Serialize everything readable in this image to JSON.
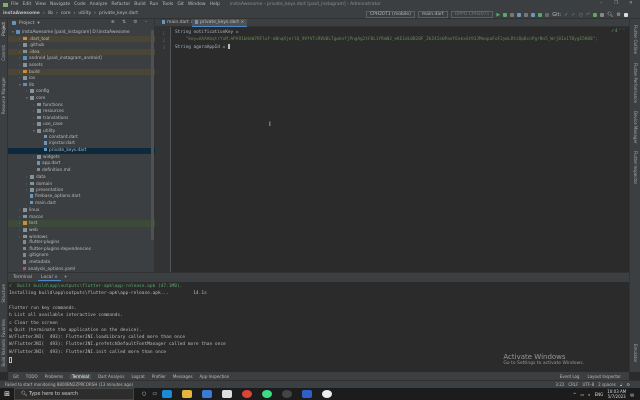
{
  "menubar": {
    "items": [
      "File",
      "Edit",
      "View",
      "Navigate",
      "Code",
      "Analyze",
      "Refactor",
      "Build",
      "Run",
      "Tools",
      "Git",
      "Window",
      "Help"
    ],
    "title": "instaAwesome - private_keys.dart [paid_instagram] - Administrator"
  },
  "breadcrumb": [
    "instaAwesome",
    "lib",
    "core",
    "utility",
    "private_keys.dart"
  ],
  "runbar": {
    "device": "CPH2071 (mobile)",
    "config": "main.dart",
    "target": "OPPO CPH2071",
    "git_label": "Git:"
  },
  "project": {
    "label": "Project",
    "rows": [
      {
        "d": 0,
        "t": "instaAwesome [paid_instagram] D:\\instaAwesome",
        "k": "folder blue",
        "e": "v"
      },
      {
        "d": 1,
        "t": ".dart_tool",
        "k": "folder orange",
        "e": ">",
        "c": "hl"
      },
      {
        "d": 1,
        "t": ".github",
        "k": "folder",
        "e": ">"
      },
      {
        "d": 1,
        "t": ".idea",
        "k": "folder",
        "e": ">",
        "c": "hl"
      },
      {
        "d": 1,
        "t": "android [paid_instagram_android]",
        "k": "folder blue",
        "e": ">"
      },
      {
        "d": 1,
        "t": "assets",
        "k": "folder",
        "e": ">"
      },
      {
        "d": 1,
        "t": "build",
        "k": "folder orange",
        "e": ">",
        "c": "hl"
      },
      {
        "d": 1,
        "t": "ios",
        "k": "folder",
        "e": ">"
      },
      {
        "d": 1,
        "t": "lib",
        "k": "folder blue",
        "e": "v"
      },
      {
        "d": 2,
        "t": "config",
        "k": "folder",
        "e": ">"
      },
      {
        "d": 2,
        "t": "core",
        "k": "folder",
        "e": "v"
      },
      {
        "d": 3,
        "t": "functions",
        "k": "folder",
        "e": ">"
      },
      {
        "d": 3,
        "t": "resources",
        "k": "folder",
        "e": ">"
      },
      {
        "d": 3,
        "t": "translations",
        "k": "folder",
        "e": ">"
      },
      {
        "d": 3,
        "t": "use_case",
        "k": "folder",
        "e": ">"
      },
      {
        "d": 3,
        "t": "utility",
        "k": "folder",
        "e": "v"
      },
      {
        "d": 4,
        "t": "constant.dart",
        "k": "file",
        "e": ""
      },
      {
        "d": 4,
        "t": "injector.dart",
        "k": "file",
        "e": ""
      },
      {
        "d": 4,
        "t": "private_keys.dart",
        "k": "file",
        "e": "",
        "c": "sel"
      },
      {
        "d": 3,
        "t": "widgets",
        "k": "folder",
        "e": ">"
      },
      {
        "d": 3,
        "t": "app.dart",
        "k": "file",
        "e": ""
      },
      {
        "d": 3,
        "t": "definition.md",
        "k": "fileg",
        "e": ""
      },
      {
        "d": 2,
        "t": "data",
        "k": "folder",
        "e": ">"
      },
      {
        "d": 2,
        "t": "domain",
        "k": "folder",
        "e": ">"
      },
      {
        "d": 2,
        "t": "presentation",
        "k": "folder",
        "e": ">"
      },
      {
        "d": 2,
        "t": "firebase_options.dart",
        "k": "file",
        "e": ""
      },
      {
        "d": 2,
        "t": "main.dart",
        "k": "file",
        "e": ""
      },
      {
        "d": 1,
        "t": "linux",
        "k": "folder",
        "e": ">"
      },
      {
        "d": 1,
        "t": "macos",
        "k": "folder",
        "e": ">"
      },
      {
        "d": 1,
        "t": "test",
        "k": "folder orange",
        "e": ">",
        "c": "green"
      },
      {
        "d": 1,
        "t": "web",
        "k": "folder",
        "e": ">"
      },
      {
        "d": 1,
        "t": "windows",
        "k": "folder",
        "e": ">"
      },
      {
        "d": 1,
        "t": ".flutter-plugins",
        "k": "fileg",
        "e": ""
      },
      {
        "d": 1,
        "t": ".flutter-plugins-dependencies",
        "k": "fileg",
        "e": ""
      },
      {
        "d": 1,
        "t": ".gitignore",
        "k": "fileg",
        "e": ""
      },
      {
        "d": 1,
        "t": ".metadata",
        "k": "fileg",
        "e": ""
      },
      {
        "d": 1,
        "t": "analysis_options.yaml",
        "k": "filer",
        "e": ""
      }
    ]
  },
  "editor": {
    "tabs": [
      "main.dart",
      "private_keys.dart"
    ],
    "active_tab": 1,
    "lines": [
      {
        "n": "1",
        "code": "String notificationKey ="
      },
      {
        "n": "2",
        "str": "    \"key=AAAAbqtrYuM:APA91bHoW7RFlof-mBnqXjerlO_9VfVTsRVU0LTgwknfjPngAg2tF0L1fRmN3_eKE1dL0B20F_ZkZ4Ie0PaeYEekxGt93JMeopaFoF2ymLRtzDpBcnPgrNn5_Wrj8Io1TBygE5K08\";"
      },
      {
        "n": "3",
        "code": "String agoraAppId = "
      }
    ],
    "inspection": "4"
  },
  "terminal": {
    "tabs": [
      "Terminal",
      "Local"
    ],
    "active_tab": 1,
    "lines": [
      {
        "t": "√  Built build\\app\\outputs\\flutter-apk\\app-release.apk (47.1MB).",
        "ok": true
      },
      {
        "t": "Installing build\\app\\outputs\\flutter-apk\\app-release.apk...         14.1s"
      },
      {
        "t": ""
      },
      {
        "t": "Flutter run key commands."
      },
      {
        "t": "h List all available interactive commands."
      },
      {
        "t": "c Clear the screen"
      },
      {
        "t": "q Quit (terminate the application on the device)."
      },
      {
        "t": "W/FlutterJNI(  493): FlutterJNI.loadLibrary called more than once"
      },
      {
        "t": "W/FlutterJNI(  493): FlutterJNI.prefetchDefaultFontManager called more than once"
      },
      {
        "t": "W/FlutterJNI(  493): FlutterJNI.init called more than once"
      }
    ]
  },
  "activate": {
    "title": "Activate Windows",
    "sub": "Go to Settings to activate Windows."
  },
  "tooltabs": {
    "items": [
      "Git",
      "TODO",
      "Problems",
      "Terminal",
      "Dart Analysis",
      "Logcat",
      "Profiler",
      "Messages",
      "App Inspection"
    ],
    "active": 3,
    "right": [
      "Event Log",
      "Layout Inspector"
    ]
  },
  "status": {
    "message": "Failed to start monitoring 8800BN2ZPRCORSH (13 minutes ago)",
    "right": [
      "3:22",
      "CRLF",
      "UTF-8",
      "2 spaces"
    ]
  },
  "leftstrip": [
    "Project",
    "Commit",
    "Resource Manager",
    "Structure",
    "Favorites",
    "Build Variants"
  ],
  "rightstrip": [
    "Flutter Outline",
    "Flutter Performance",
    "Device Manager",
    "Flutter Inspector",
    "Emulator"
  ],
  "taskbar": {
    "search_placeholder": "Type here to search",
    "lang": "ENG",
    "time": "10:03 AM",
    "date": "5/7/2023"
  },
  "colors": {
    "accent": "#4a88c7",
    "string": "#6a8759",
    "selection": "#0d293e",
    "success": "#59a869"
  }
}
